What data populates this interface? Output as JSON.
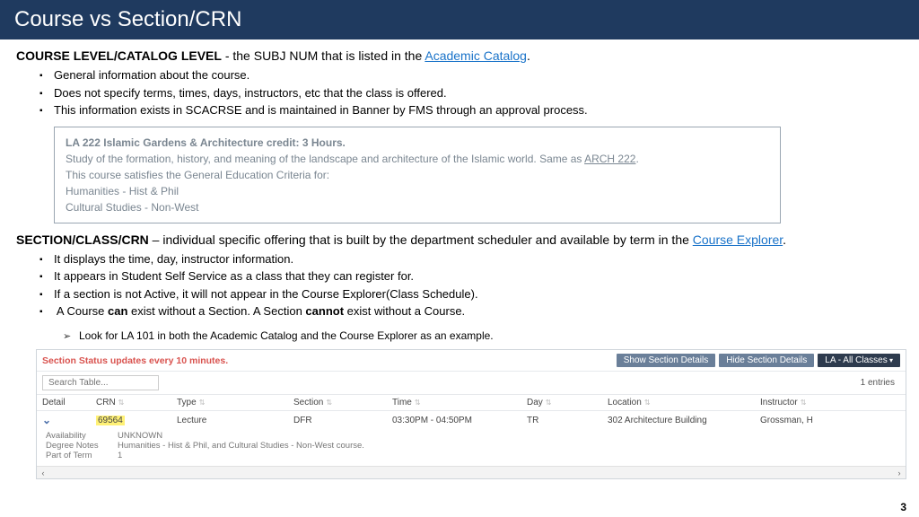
{
  "title": "Course vs Section/CRN",
  "course_level": {
    "heading_bold": "COURSE LEVEL/CATALOG LEVEL",
    "heading_rest1": " - the SUBJ NUM that is listed in the ",
    "link": "Academic Catalog",
    "heading_rest2": ".",
    "bullets": [
      "General information about the course.",
      "Does not specify terms, times, days, instructors, etc that the class is offered.",
      "This information exists in SCACRSE and is maintained in Banner by FMS through an approval process."
    ]
  },
  "catalog_sample": {
    "header": "LA 222   Islamic Gardens & Architecture   credit: 3 Hours.",
    "line1a": "Study of the formation, history, and meaning of the landscape and architecture of the Islamic world. Same as ",
    "line1_link": "ARCH 222",
    "line1b": ".",
    "line2": "This course satisfies the General Education Criteria for:",
    "line3": "Humanities - Hist & Phil",
    "line4": "Cultural Studies - Non-West"
  },
  "section_level": {
    "heading_bold": "SECTION/CLASS/CRN",
    "heading_rest1": " – individual specific offering that is built by the department scheduler and available by term in the ",
    "link": "Course Explorer",
    "heading_rest2": ".",
    "bullets": [
      "It displays the time, day, instructor information.",
      "It appears in Student Self Service as a class that they can register for.",
      "If a section is not Active, it will not appear in the Course Explorer(Class Schedule)."
    ],
    "bullet4_a": "A Course ",
    "bullet4_b": "can",
    "bullet4_c": " exist without a Section. A Section ",
    "bullet4_d": "cannot",
    "bullet4_e": " exist without a Course.",
    "sub": "Look for LA 101 in both the Academic Catalog and the Course Explorer as an example."
  },
  "explorer": {
    "status": "Section Status updates every 10 minutes.",
    "btn_show": "Show Section Details",
    "btn_hide": "Hide Section Details",
    "btn_filter": "LA - All Classes",
    "search_placeholder": "Search Table...",
    "entries": "1 entries",
    "cols": {
      "detail": "Detail",
      "crn": "CRN",
      "type": "Type",
      "section": "Section",
      "time": "Time",
      "day": "Day",
      "location": "Location",
      "instructor": "Instructor"
    },
    "row": {
      "crn": "69564",
      "type": "Lecture",
      "section": "DFR",
      "time": "03:30PM - 04:50PM",
      "day": "TR",
      "location": "302 Architecture Building",
      "instructor": "Grossman, H"
    },
    "meta": {
      "avail_lbl": "Availability",
      "avail_val": "UNKNOWN",
      "notes_lbl": "Degree Notes",
      "notes_val": "Humanities - Hist & Phil, and Cultural Studies - Non-West course.",
      "pot_lbl": "Part of Term",
      "pot_val": "1"
    }
  },
  "page_number": "3"
}
